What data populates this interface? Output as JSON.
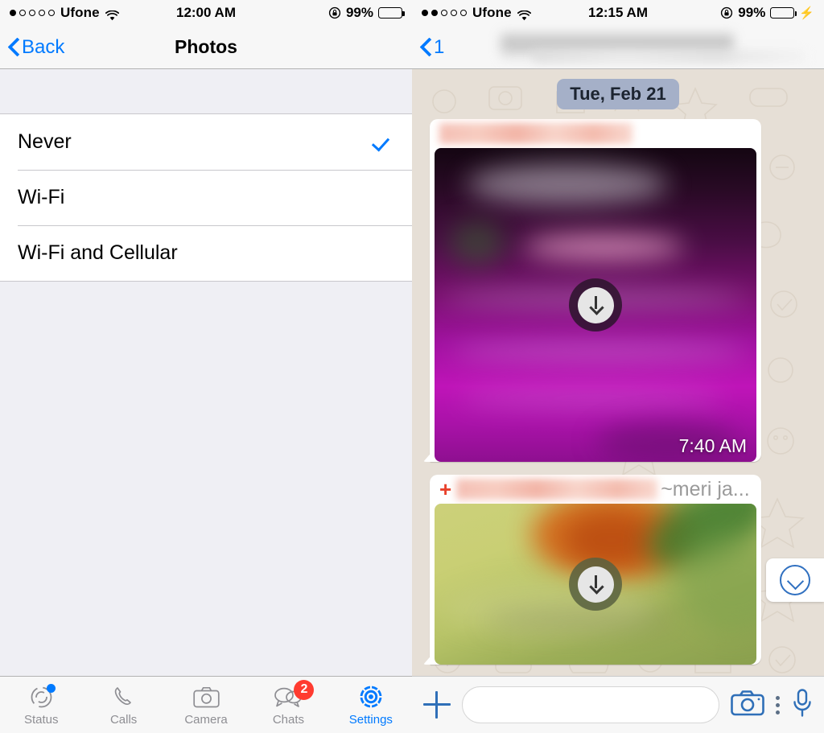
{
  "left_phone": {
    "status_bar": {
      "signal_bars_filled": 1,
      "signal_bars_total": 5,
      "carrier": "Ufone",
      "wifi_icon": "wifi-icon",
      "time": "12:00 AM",
      "rotation_lock_icon": "rotation-lock-icon",
      "battery_percent": "99%",
      "battery_color": "#000000",
      "charging": false
    },
    "nav": {
      "back_label": "Back",
      "back_icon": "chevron-left-icon",
      "title": "Photos"
    },
    "options": [
      {
        "label": "Never",
        "selected": true
      },
      {
        "label": "Wi-Fi",
        "selected": false
      },
      {
        "label": "Wi-Fi and Cellular",
        "selected": false
      }
    ],
    "check_color": "#007AFF",
    "tabs": [
      {
        "label": "Status",
        "icon": "status-ring-icon",
        "active": false,
        "dot": true,
        "badge": ""
      },
      {
        "label": "Calls",
        "icon": "phone-icon",
        "active": false,
        "dot": false,
        "badge": ""
      },
      {
        "label": "Camera",
        "icon": "camera-icon",
        "active": false,
        "dot": false,
        "badge": ""
      },
      {
        "label": "Chats",
        "icon": "chat-bubbles-icon",
        "active": false,
        "dot": false,
        "badge": "2"
      },
      {
        "label": "Settings",
        "icon": "gear-icon",
        "active": true,
        "dot": false,
        "badge": ""
      }
    ],
    "tab_active_color": "#007AFF",
    "badge_color": "#FF3B30"
  },
  "right_phone": {
    "status_bar": {
      "signal_bars_filled": 2,
      "signal_bars_total": 5,
      "carrier": "Ufone",
      "wifi_icon": "wifi-icon",
      "time": "12:15 AM",
      "rotation_lock_icon": "rotation-lock-icon",
      "battery_percent": "99%",
      "battery_color": "#4CD964",
      "charging": true,
      "charging_icon": "lightning-bolt-icon"
    },
    "nav": {
      "back_label": "1",
      "back_icon": "chevron-left-icon",
      "title": ""
    },
    "chat": {
      "date_separator": "Tue, Feb 21",
      "date_chip_color": "#A5B0C8",
      "messages": [
        {
          "sender_name": "",
          "sender_redacted": true,
          "push_name": "",
          "has_plus_prefix": false,
          "media_type": "image",
          "media_state": "not-downloaded",
          "download_icon": "download-arrow-icon",
          "time": "7:40 AM"
        },
        {
          "sender_name": "",
          "sender_redacted": true,
          "push_name": "~meri ja...",
          "has_plus_prefix": true,
          "plus_label": "+",
          "media_type": "image",
          "media_state": "not-downloaded",
          "download_icon": "download-arrow-icon",
          "time": ""
        }
      ],
      "scroll_to_bottom_icon": "circle-chevron-down-icon"
    },
    "composer": {
      "attach_icon": "plus-icon",
      "input_value": "",
      "input_placeholder": "",
      "camera_icon": "camera-icon",
      "more_icon": "vertical-dots-icon",
      "mic_icon": "microphone-icon",
      "accent_color": "#2F6FB8"
    }
  }
}
